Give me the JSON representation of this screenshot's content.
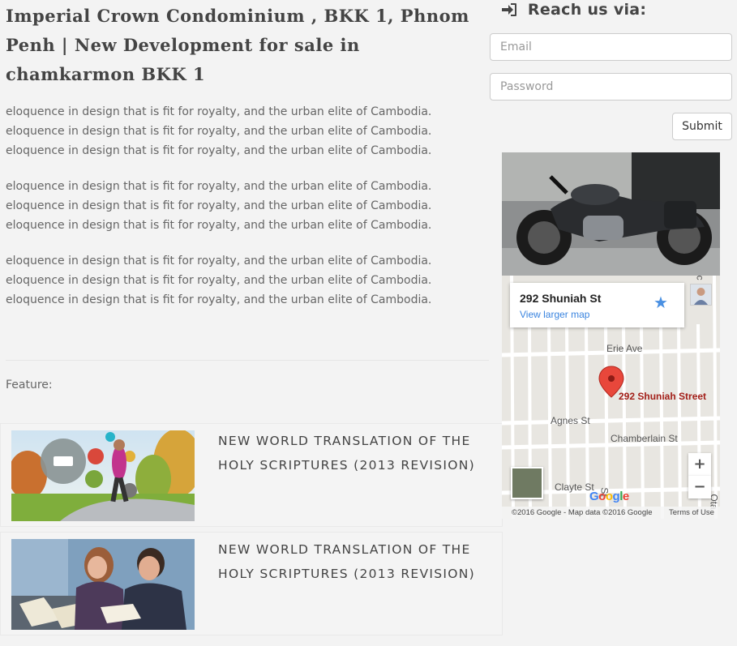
{
  "page": {
    "title": "Imperial Crown Condominium , BKK 1, Phnom Penh | New Development for sale in chamkarmon BKK 1",
    "paragraphs": [
      "eloquence in design that is fit for royalty, and the urban elite of Cambodia. eloquence in design that is fit for royalty, and the urban elite of Cambodia. eloquence in design that is fit for royalty, and the urban elite of Cambodia.",
      "eloquence in design that is fit for royalty, and the urban elite of Cambodia. eloquence in design that is fit for royalty, and the urban elite of Cambodia. eloquence in design that is fit for royalty, and the urban elite of Cambodia.",
      "eloquence in design that is fit for royalty, and the urban elite of Cambodia. eloquence in design that is fit for royalty, and the urban elite of Cambodia. eloquence in design that is fit for royalty, and the urban elite of Cambodia."
    ],
    "feature_label": "Feature:"
  },
  "features": [
    {
      "title": "NEW WORLD TRANSLATION OF THE HOLY SCRIPTURES (2013 REVISION)",
      "icon": "jogger-photo"
    },
    {
      "title": "NEW WORLD TRANSLATION OF THE HOLY SCRIPTURES (2013 REVISION)",
      "icon": "study-couple-photo"
    }
  ],
  "sidebar": {
    "heading": "Reach us via:",
    "heading_icon": "sign-in-icon",
    "email_placeholder": "Email",
    "password_placeholder": "Password",
    "submit_label": "Submit"
  },
  "map": {
    "address": "292 Shuniah St",
    "larger_map_link": "View larger map",
    "pin_label": "292 Shuniah Street",
    "streets": [
      "Erie Ave",
      "Agnes St",
      "Chamberlain St",
      "Clayte St",
      "St",
      "tc",
      "Ota"
    ],
    "zoom_in": "+",
    "zoom_out": "−",
    "copyright": "©2016 Google - Map data ©2016 Google",
    "terms": "Terms of Use",
    "pin_color": "#e8473b",
    "link_color": "#3a84df"
  }
}
